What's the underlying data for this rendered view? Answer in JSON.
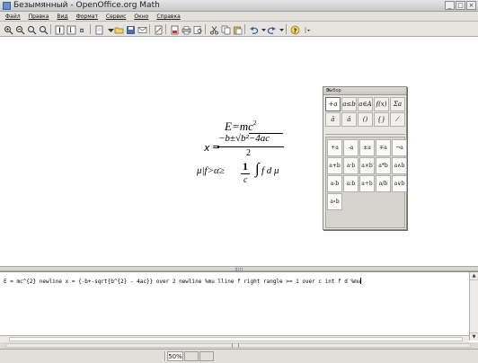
{
  "window": {
    "title": "Безымянный - OpenOffice.org Math",
    "controls": [
      "_",
      "□",
      "×"
    ]
  },
  "menu": [
    "Файл",
    "Правка",
    "Вид",
    "Формат",
    "Сервис",
    "Окно",
    "Справка"
  ],
  "formulas": {
    "f1_lhs": "E=mc",
    "f1_exp": "2",
    "f2_lhs": "x",
    "f2_eq": "=",
    "f2_num": "−b±√b²−4ac",
    "f2_den": "2",
    "f3_lhs": "μ|f>α≥",
    "f3_num": "1",
    "f3_den": "c",
    "f3_integral": "∫",
    "f3_rest": "  f  d  μ"
  },
  "selections": {
    "title": "Выбор",
    "close": "×",
    "categories": [
      "+a",
      "a≤b",
      "a∈A",
      "f(x)",
      "Σa",
      "ā",
      "â",
      "()",
      "{}",
      "⁄"
    ],
    "operators": [
      "+a",
      "-a",
      "±a",
      "∓a",
      "¬a",
      "a+b",
      "a·b",
      "a×b",
      "a*b",
      "a∧b",
      "a-b",
      "a:b",
      "a÷b",
      "a/b",
      "a∨b",
      "a∘b"
    ]
  },
  "command": {
    "text": "E = mc^{2} newline x = {-b+-sqrt{b^{2} - 4ac}} over 2 newline %mu lline f right rangle >= 1 over c int f d %mu"
  },
  "status": {
    "zoom": "50%"
  }
}
